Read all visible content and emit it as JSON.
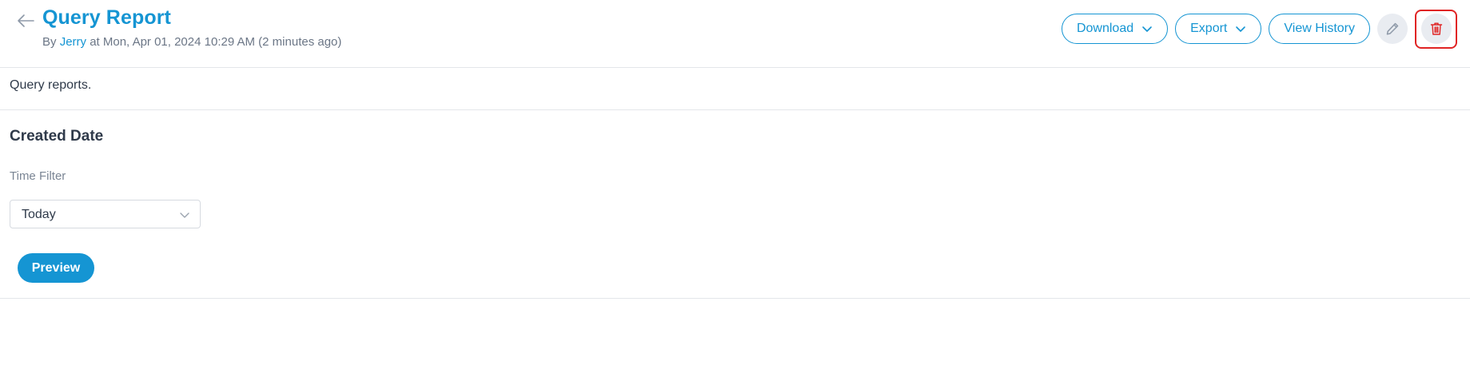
{
  "header": {
    "title": "Query Report",
    "meta_prefix": "By ",
    "author": "Jerry",
    "meta_suffix": " at Mon, Apr 01, 2024 10:29 AM (2 minutes ago)"
  },
  "toolbar": {
    "download_label": "Download",
    "export_label": "Export",
    "history_label": "View History",
    "edit_icon": "pencil-icon",
    "delete_icon": "trash-icon"
  },
  "description": "Query reports.",
  "section": {
    "title": "Created Date",
    "filter_label": "Time Filter",
    "filter_value": "Today"
  },
  "preview_label": "Preview",
  "colors": {
    "accent": "#1595d3",
    "danger": "#e02424",
    "text": "#2f3a4a",
    "muted": "#7a8594"
  }
}
